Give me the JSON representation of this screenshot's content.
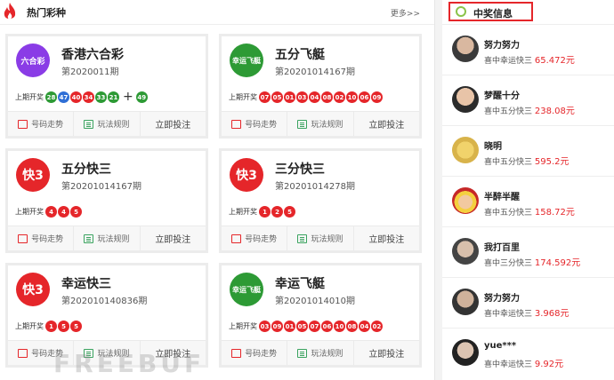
{
  "left": {
    "title": "热门彩种",
    "more": "更多>>"
  },
  "prev_label": "上期开奖",
  "actions": {
    "trend": "号码走势",
    "rules": "玩法规则",
    "bet": "立即投注"
  },
  "cards": [
    {
      "name": "香港六合彩",
      "issue": "第2020011期",
      "logo_text": "六合彩",
      "logo_color": "#8a3ce6",
      "balls": [
        "28",
        "47",
        "40",
        "34",
        "33",
        "21"
      ],
      "ball_colors": [
        "g",
        "b",
        "r",
        "r",
        "g",
        "g"
      ],
      "special": "49",
      "special_color": "g"
    },
    {
      "name": "五分飞艇",
      "issue": "第20201014167期",
      "logo_text": "幸运飞艇",
      "logo_color": "#2d9a35",
      "balls": [
        "07",
        "05",
        "01",
        "03",
        "04",
        "08",
        "02",
        "10",
        "06",
        "09"
      ]
    },
    {
      "name": "五分快三",
      "issue": "第20201014167期",
      "logo_text": "快3",
      "logo_color": "#e5262a",
      "balls": [
        "4",
        "4",
        "5"
      ]
    },
    {
      "name": "三分快三",
      "issue": "第20201014278期",
      "logo_text": "快3",
      "logo_color": "#e5262a",
      "balls": [
        "1",
        "2",
        "5"
      ]
    },
    {
      "name": "幸运快三",
      "issue": "第20201014083​6期",
      "logo_text": "快3",
      "logo_color": "#e5262a",
      "balls": [
        "1",
        "5",
        "5"
      ]
    },
    {
      "name": "幸运飞艇",
      "issue": "第20201014010期",
      "logo_text": "幸运飞艇",
      "logo_color": "#2d9a35",
      "balls": [
        "03",
        "09",
        "01",
        "05",
        "07",
        "06",
        "10",
        "08",
        "04",
        "02"
      ]
    }
  ],
  "right": {
    "title": "中奖信息",
    "winners": [
      {
        "name": "努力努力",
        "game": "喜中幸运快三",
        "amount": "65.472元"
      },
      {
        "name": "梦醒十分",
        "game": "喜中五分快三",
        "amount": "238.08元"
      },
      {
        "name": "晓明",
        "game": "喜中五分快三",
        "amount": "595.2元"
      },
      {
        "name": "半醉半醒",
        "game": "喜中五分快三",
        "amount": "158.72元"
      },
      {
        "name": "我打百里",
        "game": "喜中三分快三",
        "amount": "174.592元"
      },
      {
        "name": "努力努力",
        "game": "喜中幸运快三",
        "amount": "3.968元"
      },
      {
        "name": "yue***",
        "game": "喜中幸运快三",
        "amount": "9.92元"
      }
    ]
  },
  "watermark": "FREEBUF"
}
